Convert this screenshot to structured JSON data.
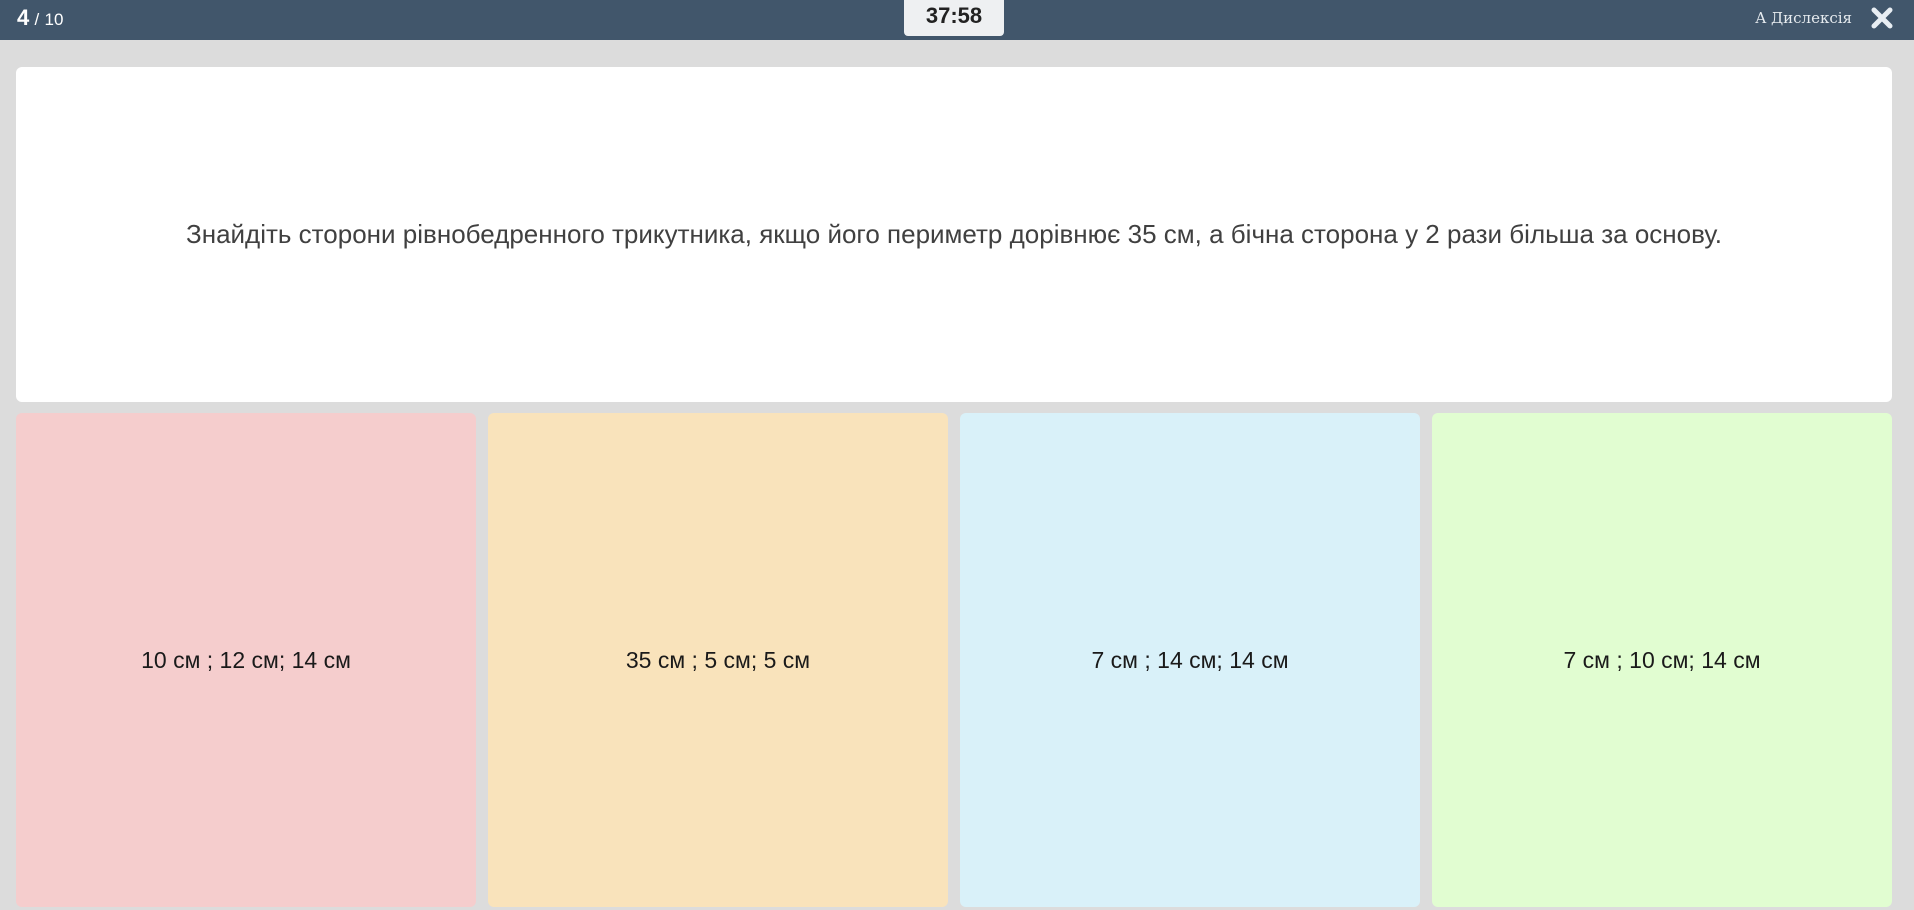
{
  "header": {
    "progress_current": "4",
    "progress_separator": "/",
    "progress_total": "10",
    "timer": "37:58",
    "dyslexia_label": "A Дислексія",
    "close_icon": "close-icon"
  },
  "question": {
    "text": "Знайдіть сторони рівнобедренного трикутника, якщо його периметр дорівнює 35 см, а бічна сторона у 2 рази більша за основу."
  },
  "answers": [
    {
      "label": "10 см ; 12 см; 14 см",
      "color": "#f5cdcd"
    },
    {
      "label": "35 см ; 5 см; 5 см",
      "color": "#f9e3bb"
    },
    {
      "label": "7 см ; 14 см; 14 см",
      "color": "#d9f1f9"
    },
    {
      "label": "7 см ; 10 см; 14 см",
      "color": "#e1fdd1"
    }
  ],
  "colors": {
    "topbar": "#41566b",
    "background": "#dcdcdc"
  }
}
